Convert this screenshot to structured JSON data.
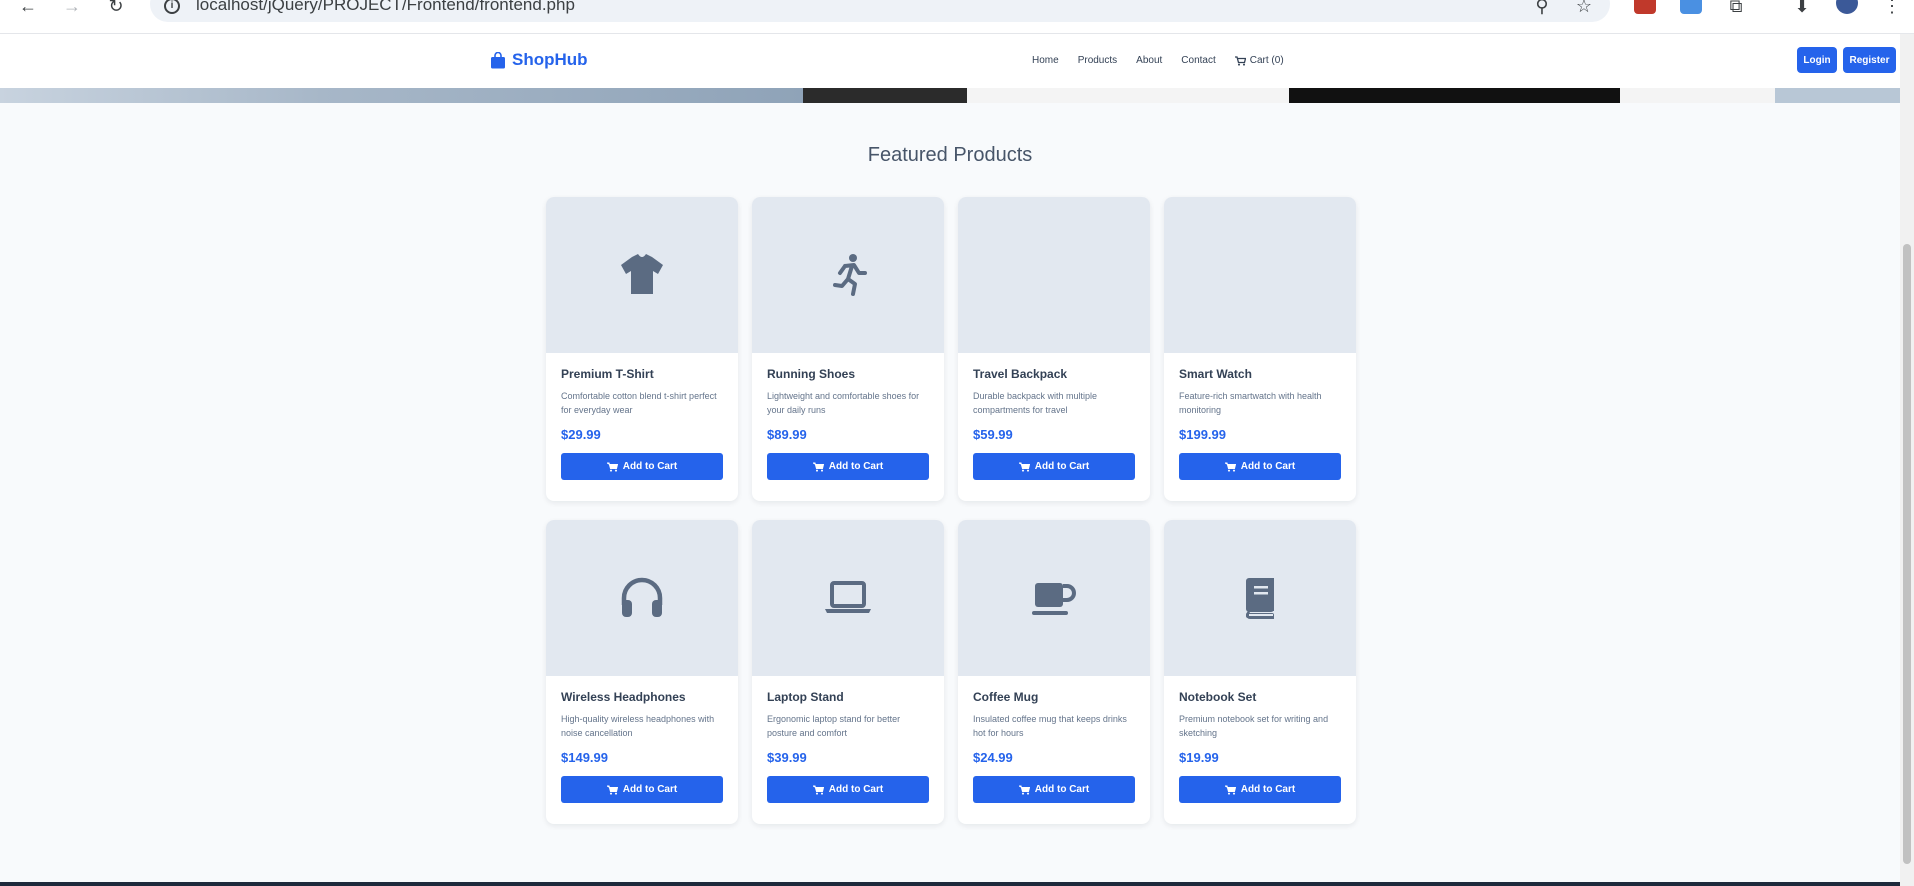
{
  "browser": {
    "url": "localhost/jQuery/PROJECT/Frontend/frontend.php"
  },
  "header": {
    "logo": "ShopHub",
    "nav": [
      {
        "label": "Home"
      },
      {
        "label": "Products"
      },
      {
        "label": "About"
      },
      {
        "label": "Contact"
      },
      {
        "label": "Cart (0)"
      }
    ],
    "login_label": "Login",
    "register_label": "Register"
  },
  "section": {
    "title": "Featured Products"
  },
  "products": [
    {
      "name": "Premium T-Shirt",
      "description": "Comfortable cotton blend t-shirt perfect for everyday wear",
      "price": "$29.99",
      "button": "Add to Cart",
      "icon": "tshirt-icon"
    },
    {
      "name": "Running Shoes",
      "description": "Lightweight and comfortable shoes for your daily runs",
      "price": "$89.99",
      "button": "Add to Cart",
      "icon": "running-icon"
    },
    {
      "name": "Travel Backpack",
      "description": "Durable backpack with multiple compartments for travel",
      "price": "$59.99",
      "button": "Add to Cart",
      "icon": "none"
    },
    {
      "name": "Smart Watch",
      "description": "Feature-rich smartwatch with health monitoring",
      "price": "$199.99",
      "button": "Add to Cart",
      "icon": "none"
    },
    {
      "name": "Wireless Headphones",
      "description": "High-quality wireless headphones with noise cancellation",
      "price": "$149.99",
      "button": "Add to Cart",
      "icon": "headphones-icon"
    },
    {
      "name": "Laptop Stand",
      "description": "Ergonomic laptop stand for better posture and comfort",
      "price": "$39.99",
      "button": "Add to Cart",
      "icon": "laptop-icon"
    },
    {
      "name": "Coffee Mug",
      "description": "Insulated coffee mug that keeps drinks hot for hours",
      "price": "$24.99",
      "button": "Add to Cart",
      "icon": "mug-icon"
    },
    {
      "name": "Notebook Set",
      "description": "Premium notebook set for writing and sketching",
      "price": "$19.99",
      "button": "Add to Cart",
      "icon": "book-icon"
    }
  ],
  "colors": {
    "primary": "#2563eb",
    "icon": "#5b6b82",
    "card_image_bg": "#e2e8f0"
  }
}
